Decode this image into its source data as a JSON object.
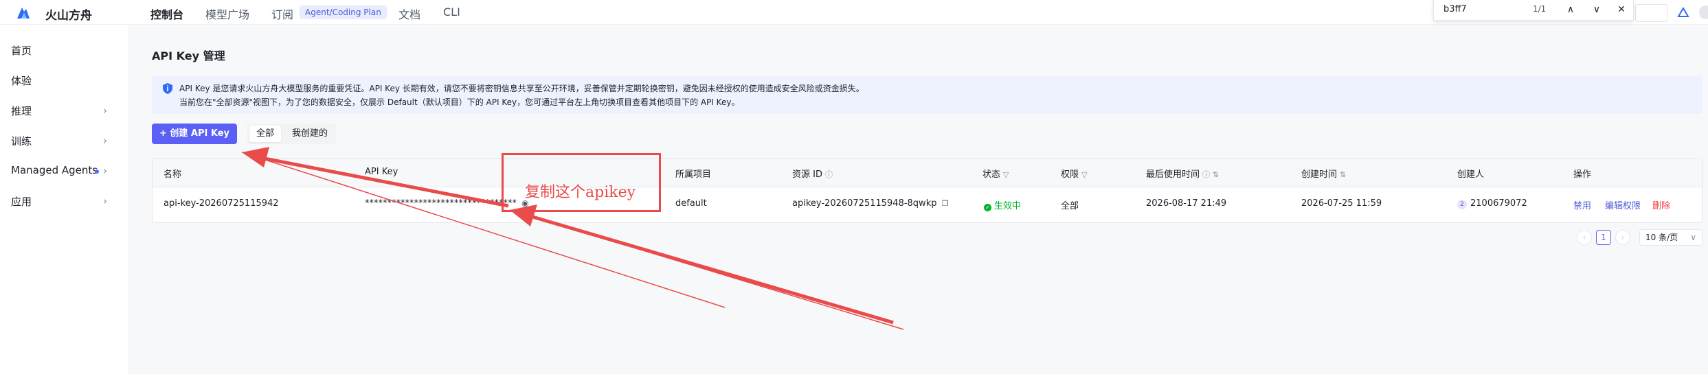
{
  "brand": {
    "name": "火山方舟"
  },
  "topnav": {
    "items": [
      "控制台",
      "模型广场",
      "订阅",
      "文档",
      "CLI"
    ],
    "badge": "Agent/Coding Plan"
  },
  "find": {
    "query": "b3ff7",
    "count": "1/1",
    "up": "∧",
    "down": "∨",
    "close": "✕"
  },
  "sidebar": {
    "items": [
      {
        "label": "首页"
      },
      {
        "label": "体验"
      },
      {
        "label": "推理",
        "chevron": "›"
      },
      {
        "label": "训练",
        "chevron": "›"
      },
      {
        "label": "Managed Agents",
        "chevron": "›"
      },
      {
        "label": "应用",
        "chevron": "›"
      }
    ]
  },
  "page": {
    "title": "API Key 管理"
  },
  "notice": {
    "line1": "API Key 是您请求火山方舟大模型服务的重要凭证。API Key 长期有效，请您不要将密钥信息共享至公开环境，妥善保管并定期轮换密钥，避免因未经授权的使用造成安全风险或资金损失。",
    "line2": "当前您在\"全部资源\"视图下，为了您的数据安全，仅展示 Default（默认项目）下的 API Key，您可通过平台左上角切换项目查看其他项目下的 API Key。"
  },
  "toolbar": {
    "create_label": "+ 创建 API Key",
    "filter_all": "全部",
    "filter_mine": "我创建的"
  },
  "table": {
    "columns": [
      "名称",
      "API Key",
      "所属项目",
      "资源 ID",
      "状态",
      "权限",
      "最后使用时间",
      "创建时间",
      "创建人",
      "操作"
    ],
    "rows": [
      {
        "name": "api-key-20260725115942",
        "key": "**********************************",
        "project": "default",
        "resource_id": "apikey-20260725115948-8qwkp",
        "status": "生效中",
        "permission": "全部",
        "last_used": "2026-08-17 21:49",
        "created": "2026-07-25 11:59",
        "creator": "2100679072",
        "creator_initial": "2",
        "actions": [
          "禁用",
          "编辑权限",
          "删除"
        ]
      }
    ]
  },
  "pagination": {
    "prev": "‹",
    "current": "1",
    "next": "›",
    "page_size": "10 条/页"
  },
  "annotation": {
    "text": "复制这个apikey",
    "color": "#e94b4b"
  },
  "colors": {
    "primary": "#5b5ff6",
    "success": "#00b42a",
    "danger": "#f53f3f",
    "annotation": "#e94b4b"
  }
}
